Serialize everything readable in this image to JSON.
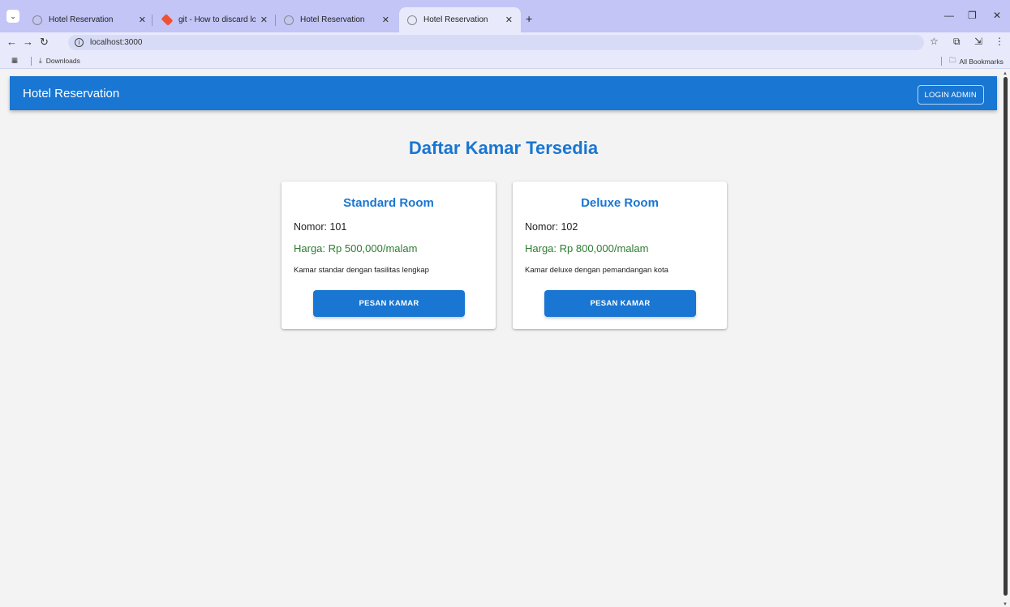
{
  "browser": {
    "tabs": [
      {
        "title": "Hotel Reservation"
      },
      {
        "title": "git - How to discard local chang"
      },
      {
        "title": "Hotel Reservation"
      },
      {
        "title": "Hotel Reservation"
      }
    ],
    "url": "localhost:3000",
    "bookmarks": {
      "downloads_label": "Downloads",
      "all_bookmarks_label": "All Bookmarks"
    }
  },
  "app": {
    "brand": "Hotel Reservation",
    "login_label": "LOGIN ADMIN",
    "heading": "Daftar Kamar Tersedia",
    "rooms": [
      {
        "name": "Standard Room",
        "nomor": "Nomor: 101",
        "harga": "Harga: Rp 500,000/malam",
        "description": "Kamar standar dengan fasilitas lengkap",
        "button_label": "PESAN KAMAR"
      },
      {
        "name": "Deluxe Room",
        "nomor": "Nomor: 102",
        "harga": "Harga: Rp 800,000/malam",
        "description": "Kamar deluxe dengan pemandangan kota",
        "button_label": "PESAN KAMAR"
      }
    ]
  },
  "colors": {
    "primary": "#1976d2",
    "price": "#2e7d32",
    "background": "#f3f3f3"
  }
}
